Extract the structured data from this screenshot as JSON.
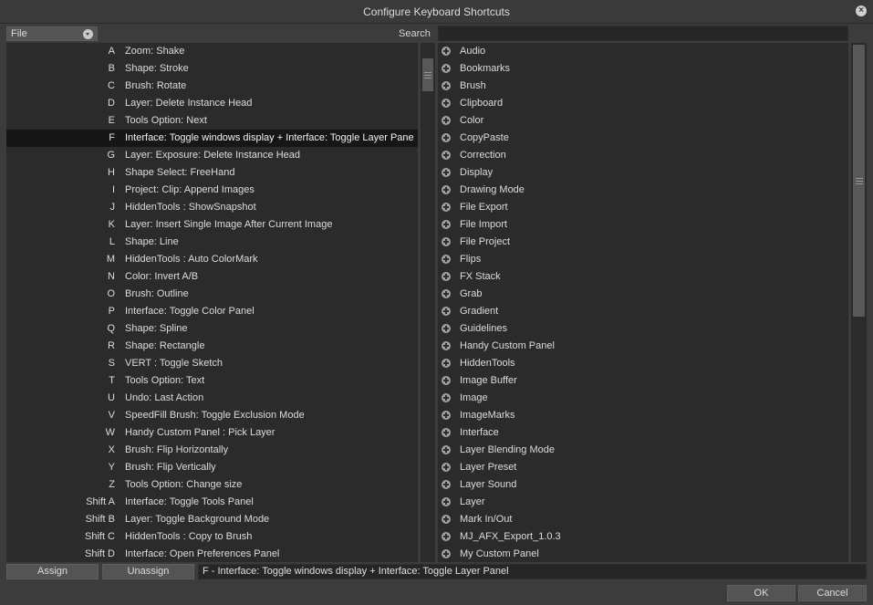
{
  "window": {
    "title": "Configure Keyboard Shortcuts",
    "close_icon": "close-icon"
  },
  "category": {
    "selected": "File"
  },
  "search": {
    "label": "Search",
    "value": "",
    "placeholder": ""
  },
  "shortcuts": [
    {
      "key": "A",
      "command": "Zoom: Shake"
    },
    {
      "key": "B",
      "command": "Shape: Stroke"
    },
    {
      "key": "C",
      "command": "Brush: Rotate"
    },
    {
      "key": "D",
      "command": "Layer: Delete Instance Head"
    },
    {
      "key": "E",
      "command": "Tools Option: Next"
    },
    {
      "key": "F",
      "command": "Interface: Toggle windows display + Interface: Toggle Layer Pane",
      "selected": true
    },
    {
      "key": "G",
      "command": "Layer: Exposure: Delete Instance Head"
    },
    {
      "key": "H",
      "command": "Shape Select: FreeHand"
    },
    {
      "key": "I",
      "command": "Project: Clip: Append Images"
    },
    {
      "key": "J",
      "command": "HiddenTools : ShowSnapshot"
    },
    {
      "key": "K",
      "command": "Layer: Insert Single Image After Current Image"
    },
    {
      "key": "L",
      "command": "Shape: Line"
    },
    {
      "key": "M",
      "command": "HiddenTools : Auto ColorMark"
    },
    {
      "key": "N",
      "command": "Color: Invert A/B"
    },
    {
      "key": "O",
      "command": "Brush: Outline"
    },
    {
      "key": "P",
      "command": "Interface: Toggle Color Panel"
    },
    {
      "key": "Q",
      "command": "Shape: Spline"
    },
    {
      "key": "R",
      "command": "Shape: Rectangle"
    },
    {
      "key": "S",
      "command": "VERT : Toggle Sketch"
    },
    {
      "key": "T",
      "command": "Tools Option: Text"
    },
    {
      "key": "U",
      "command": "Undo: Last Action"
    },
    {
      "key": "V",
      "command": "SpeedFill Brush: Toggle Exclusion Mode"
    },
    {
      "key": "W",
      "command": "Handy Custom Panel : Pick Layer"
    },
    {
      "key": "X",
      "command": "Brush: Flip Horizontally"
    },
    {
      "key": "Y",
      "command": "Brush: Flip Vertically"
    },
    {
      "key": "Z",
      "command": "Tools Option: Change size"
    },
    {
      "key": "Shift A",
      "command": "Interface: Toggle Tools Panel"
    },
    {
      "key": "Shift B",
      "command": "Layer: Toggle Background Mode"
    },
    {
      "key": "Shift C",
      "command": "HiddenTools : Copy to Brush"
    },
    {
      "key": "Shift D",
      "command": "Interface: Open Preferences Panel"
    }
  ],
  "groups": [
    "Audio",
    "Bookmarks",
    "Brush",
    "Clipboard",
    "Color",
    "CopyPaste",
    "Correction",
    "Display",
    "Drawing Mode",
    "File Export",
    "File Import",
    "File Project",
    "Flips",
    "FX Stack",
    "Grab",
    "Gradient",
    "Guidelines",
    "Handy Custom Panel",
    "HiddenTools",
    "Image Buffer",
    "Image",
    "ImageMarks",
    "Interface",
    "Layer Blending Mode",
    "Layer Preset",
    "Layer Sound",
    "Layer",
    "Mark In/Out",
    "MJ_AFX_Export_1.0.3",
    "My Custom Panel"
  ],
  "footer": {
    "assign_label": "Assign",
    "unassign_label": "Unassign",
    "current_shortcut": "F - Interface: Toggle windows display + Interface: Toggle Layer Panel",
    "ok_label": "OK",
    "cancel_label": "Cancel"
  }
}
